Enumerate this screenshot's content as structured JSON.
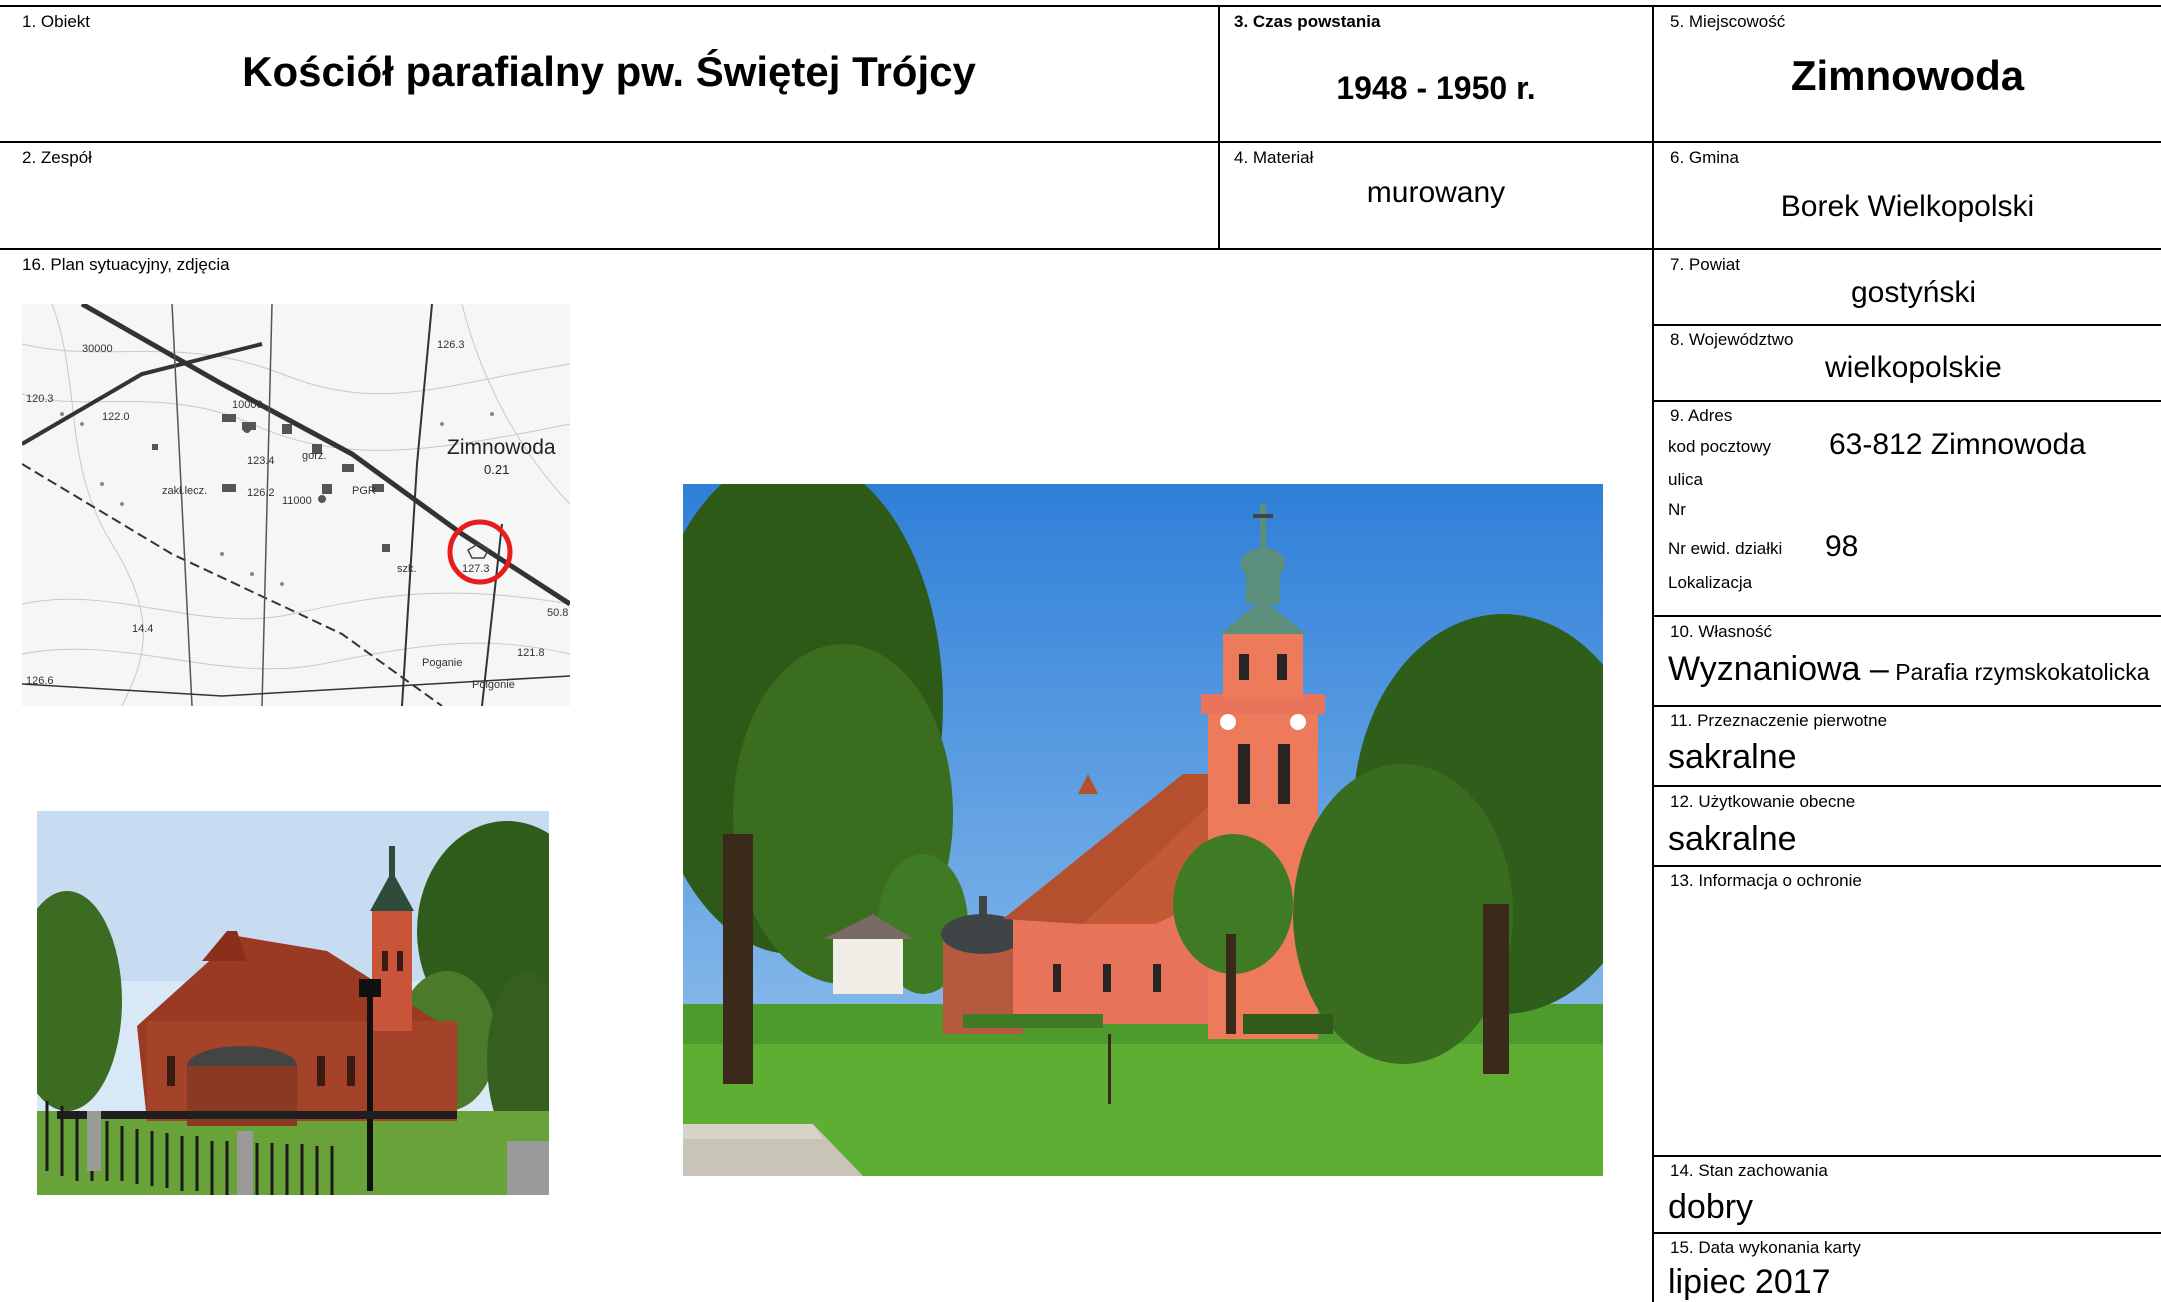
{
  "fields": {
    "obiekt": {
      "label": "1. Obiekt",
      "value": "Kościół parafialny pw. Świętej Trójcy"
    },
    "zespol": {
      "label": "2. Zespół",
      "value": ""
    },
    "czas": {
      "label": "3. Czas powstania",
      "value": "1948 - 1950 r."
    },
    "material": {
      "label": "4. Materiał",
      "value": "murowany"
    },
    "miejscowosc": {
      "label": "5. Miejscowość",
      "value": "Zimnowoda"
    },
    "gmina": {
      "label": "6. Gmina",
      "value": "Borek Wielkopolski"
    },
    "powiat": {
      "label": "7. Powiat",
      "value": "gostyński"
    },
    "wojewodztwo": {
      "label": "8. Województwo",
      "value": "wielkopolskie"
    },
    "adres": {
      "label": "9. Adres",
      "kod_label": "kod pocztowy",
      "kod_value": "63-812 Zimnowoda",
      "ulica_label": "ulica",
      "nr_label": "Nr",
      "dzialka_label": "Nr ewid. działki",
      "dzialka_value": "98",
      "lokalizacja_label": "Lokalizacja"
    },
    "wlasnosc": {
      "label": "10. Własność",
      "value": "Wyznaniowa –",
      "detail": " Parafia rzymskokatolicka"
    },
    "przeznaczenie": {
      "label": "11. Przeznaczenie pierwotne",
      "value": "sakralne"
    },
    "uzytkowanie": {
      "label": "12. Użytkowanie obecne",
      "value": "sakralne"
    },
    "ochrona": {
      "label": "13. Informacja o ochronie",
      "value": ""
    },
    "stan": {
      "label": "14. Stan zachowania",
      "value": "dobry"
    },
    "data": {
      "label": "15. Data wykonania karty",
      "value": "lipiec  2017"
    },
    "plan": {
      "label": "16. Plan sytuacyjny, zdjęcia"
    }
  },
  "map": {
    "place_label": "Zimnowoda",
    "place_sub": "0.21",
    "labels": [
      "30000",
      "10000",
      "126.3",
      "120.3",
      "122.0",
      "PGR",
      "gorz.",
      "zakł.lecz.",
      "11000",
      "126.2",
      "123.4",
      "szk.",
      "127.3",
      "14.4",
      "126.6",
      "121.8",
      "50.8",
      "Poganie",
      "Polgonie"
    ]
  },
  "photos": {
    "small": "church-photo-side",
    "large": "church-photo-front"
  },
  "colors": {
    "line": "#000000",
    "marker": "#e81c1c",
    "sky": "#5f9fe0",
    "grass": "#4f9a2c",
    "wall": "#e77458",
    "roof": "#b4502e"
  }
}
